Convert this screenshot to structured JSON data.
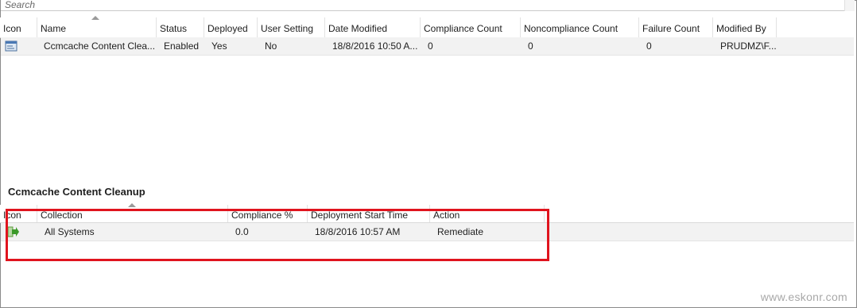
{
  "search": {
    "placeholder": "Search"
  },
  "upper_table": {
    "columns": [
      "Icon",
      "Name",
      "Status",
      "Deployed",
      "User Setting",
      "Date Modified",
      "Compliance Count",
      "Noncompliance Count",
      "Failure Count",
      "Modified By"
    ],
    "rows": [
      {
        "icon": "configuration-baseline-icon",
        "name": "Ccmcache Content Clea...",
        "status": "Enabled",
        "deployed": "Yes",
        "user_setting": "No",
        "date_modified": "18/8/2016 10:50 A...",
        "compliance_count": "0",
        "noncompliance_count": "0",
        "failure_count": "0",
        "modified_by": "PRUDMZ\\F..."
      }
    ]
  },
  "details": {
    "title": "Ccmcache Content Cleanup",
    "columns": [
      "Icon",
      "Collection",
      "Compliance %",
      "Deployment Start Time",
      "Action"
    ],
    "rows": [
      {
        "icon": "deployment-arrow-icon",
        "collection": "All Systems",
        "compliance": "0.0",
        "start_time": "18/8/2016 10:57 AM",
        "action": "Remediate"
      }
    ]
  },
  "highlight_color": "#e0141e",
  "watermark": "www.eskonr.com"
}
